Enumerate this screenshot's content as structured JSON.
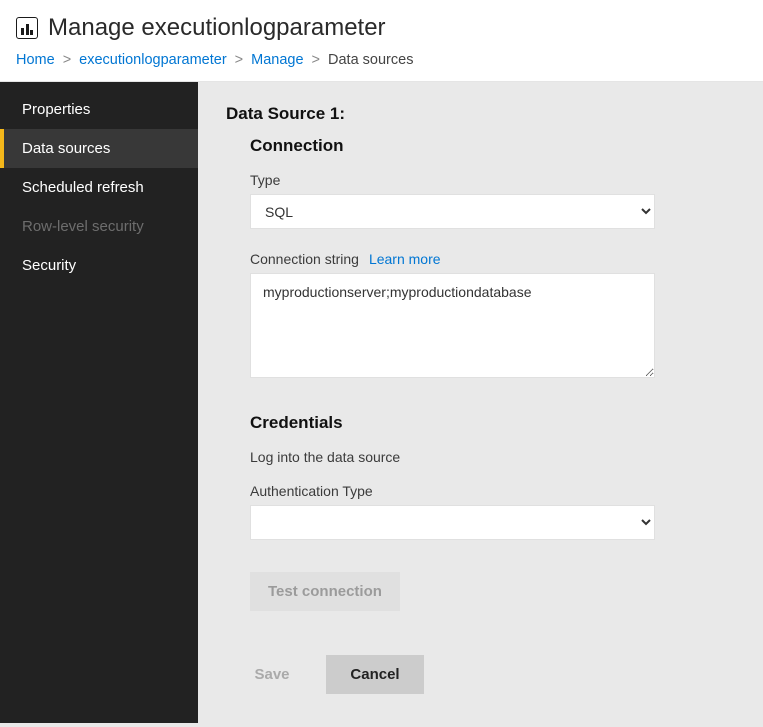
{
  "header": {
    "title": "Manage executionlogparameter"
  },
  "breadcrumb": {
    "items": [
      {
        "label": "Home",
        "link": true
      },
      {
        "label": "executionlogparameter",
        "link": true
      },
      {
        "label": "Manage",
        "link": true
      },
      {
        "label": "Data sources",
        "link": false
      }
    ],
    "separator": ">"
  },
  "sidebar": {
    "items": [
      {
        "label": "Properties",
        "active": false,
        "disabled": false
      },
      {
        "label": "Data sources",
        "active": true,
        "disabled": false
      },
      {
        "label": "Scheduled refresh",
        "active": false,
        "disabled": false
      },
      {
        "label": "Row-level security",
        "active": false,
        "disabled": true
      },
      {
        "label": "Security",
        "active": false,
        "disabled": false
      }
    ]
  },
  "main": {
    "section_title": "Data Source 1:",
    "connection": {
      "title": "Connection",
      "type_label": "Type",
      "type_value": "SQL",
      "connstr_label": "Connection string",
      "learn_more": "Learn more",
      "connstr_value": "myproductionserver;myproductiondatabase"
    },
    "credentials": {
      "title": "Credentials",
      "subtext": "Log into the data source",
      "authtype_label": "Authentication Type",
      "authtype_value": "",
      "test_btn": "Test connection"
    }
  },
  "actions": {
    "save": "Save",
    "cancel": "Cancel"
  }
}
